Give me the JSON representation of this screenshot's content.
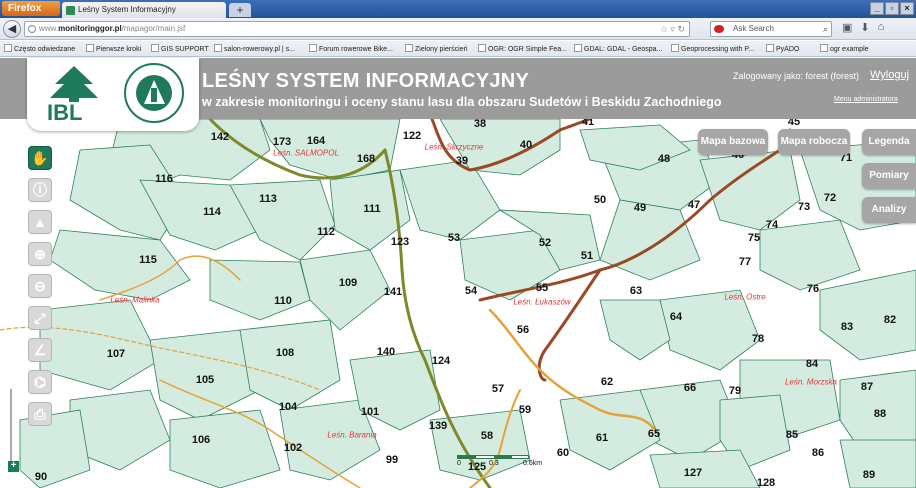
{
  "browser": {
    "menu_label": "Firefox",
    "tab_title": "Leśny System Informacyjny",
    "new_tab_label": "+",
    "url_prefix": "www.",
    "url_domain": "monitoringgor.pl",
    "url_path": "/mapagor/main.jsf",
    "search_placeholder": "Ask Search",
    "bookmarks": [
      "Często odwiedzane",
      "Pierwsze kroki",
      "GIS SUPPORT",
      "salon-rowerowy.pl | s...",
      "Forum rowerowe Bike...",
      "Zielony pierścień",
      "OGR: OGR Simple Fea...",
      "GDAL: GDAL - Geospa...",
      "Geoprocessing with P...",
      "PyADO",
      "ogr example"
    ]
  },
  "header": {
    "logo_text": "IBL",
    "seal_text": "LASY PAŃSTWOWE",
    "title": "LEŚNY SYSTEM INFORMACYJNY",
    "subtitle": "w zakresie monitoringu i oceny stanu lasu dla obszaru Sudetów i Beskidu Zachodniego",
    "login_label": "Zalogowany jako: forest (forest)",
    "logout_label": "Wyloguj",
    "admin_menu_label": "Menu administratora"
  },
  "map": {
    "base_map_button": "Mapa bazowa",
    "working_map_button": "Mapa robocza",
    "panel_buttons": [
      "Legenda",
      "Pomiary",
      "Analizy"
    ],
    "scale_labels": [
      "0",
      "0.3",
      "0.6km"
    ],
    "tools": [
      "hand-icon",
      "info-icon",
      "feature-info-icon",
      "zoom-in-icon",
      "zoom-out-icon",
      "full-extent-icon",
      "measure-line-icon",
      "measure-area-icon",
      "print-icon"
    ],
    "zoom_plus": "+",
    "forest_districts": [
      "Leśn. SALMOPOL",
      "Leśn. Skrzyczne",
      "Leśn. Malinka",
      "Leśn. Łukaszów",
      "Leśn. Ostre",
      "Leśn. Morzska",
      "Leśn. Barania"
    ],
    "compartments": [
      "142",
      "173",
      "164",
      "122",
      "38",
      "41",
      "45",
      "116",
      "168",
      "39",
      "40",
      "48",
      "46",
      "71",
      "114",
      "113",
      "111",
      "50",
      "49",
      "47",
      "73",
      "72",
      "112",
      "123",
      "53",
      "52",
      "75",
      "74",
      "115",
      "51",
      "77",
      "109",
      "141",
      "54",
      "55",
      "63",
      "76",
      "110",
      "64",
      "56",
      "82",
      "83",
      "78",
      "107",
      "108",
      "140",
      "124",
      "62",
      "84",
      "105",
      "57",
      "66",
      "79",
      "87",
      "104",
      "101",
      "59",
      "88",
      "139",
      "58",
      "65",
      "61",
      "85",
      "106",
      "102",
      "99",
      "60",
      "125",
      "86",
      "127",
      "128",
      "89",
      "90"
    ],
    "colors": {
      "forest_fill": "#d3ecdf",
      "forest_stroke": "#2e7f63",
      "road_brown": "#9a4a22",
      "road_olive": "#7e8a2a",
      "trail_orange": "#e5a23a",
      "district_label": "#e03838"
    }
  }
}
